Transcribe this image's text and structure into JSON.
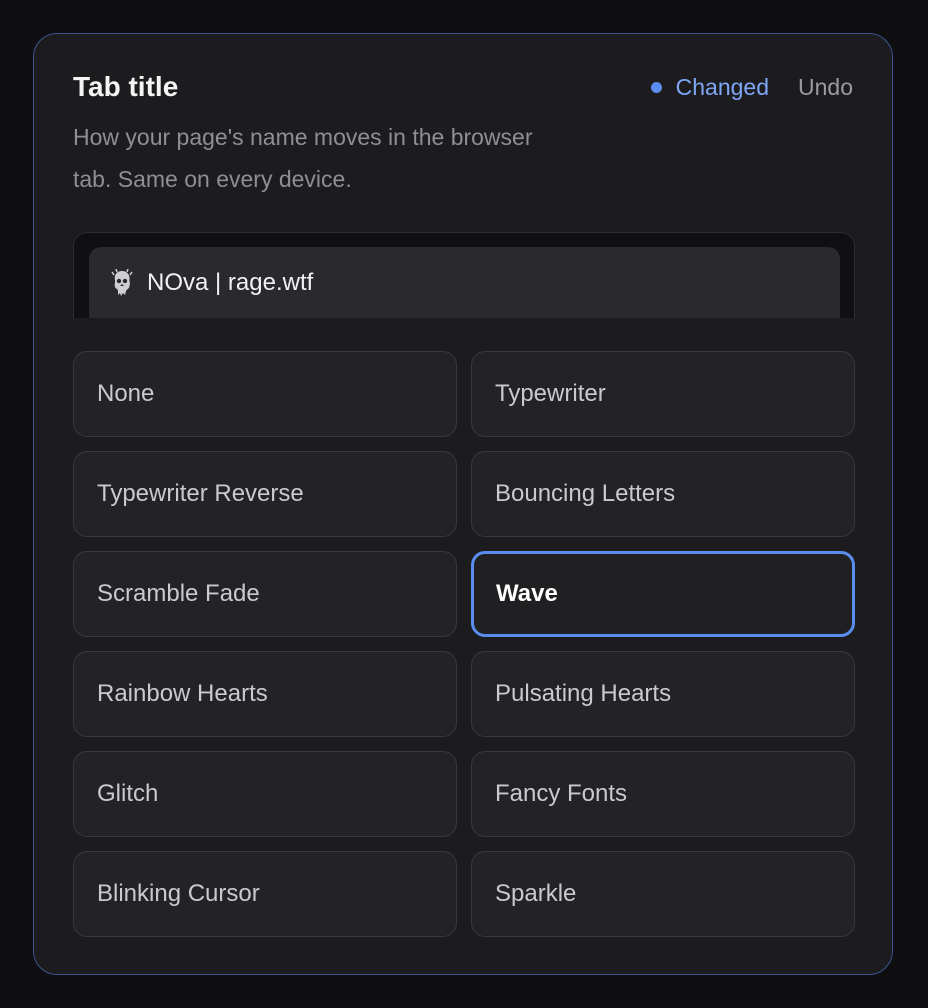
{
  "card": {
    "title": "Tab title",
    "status_label": "Changed",
    "undo_label": "Undo",
    "description": "How your page's name moves in the browser tab. Same on every device."
  },
  "preview": {
    "tab_text": "NOva | rage.wtf"
  },
  "options": [
    {
      "label": "None",
      "selected": false
    },
    {
      "label": "Typewriter",
      "selected": false
    },
    {
      "label": "Typewriter Reverse",
      "selected": false
    },
    {
      "label": "Bouncing Letters",
      "selected": false
    },
    {
      "label": "Scramble Fade",
      "selected": false
    },
    {
      "label": "Wave",
      "selected": true
    },
    {
      "label": "Rainbow Hearts",
      "selected": false
    },
    {
      "label": "Pulsating Hearts",
      "selected": false
    },
    {
      "label": "Glitch",
      "selected": false
    },
    {
      "label": "Fancy Fonts",
      "selected": false
    },
    {
      "label": "Blinking Cursor",
      "selected": false
    },
    {
      "label": "Sparkle",
      "selected": false
    }
  ],
  "colors": {
    "accent": "#5b8def",
    "card_border": "#3b5591",
    "background": "#0f0f11"
  },
  "icons": {
    "favicon": "skull-favicon-icon",
    "status": "dot-icon"
  }
}
